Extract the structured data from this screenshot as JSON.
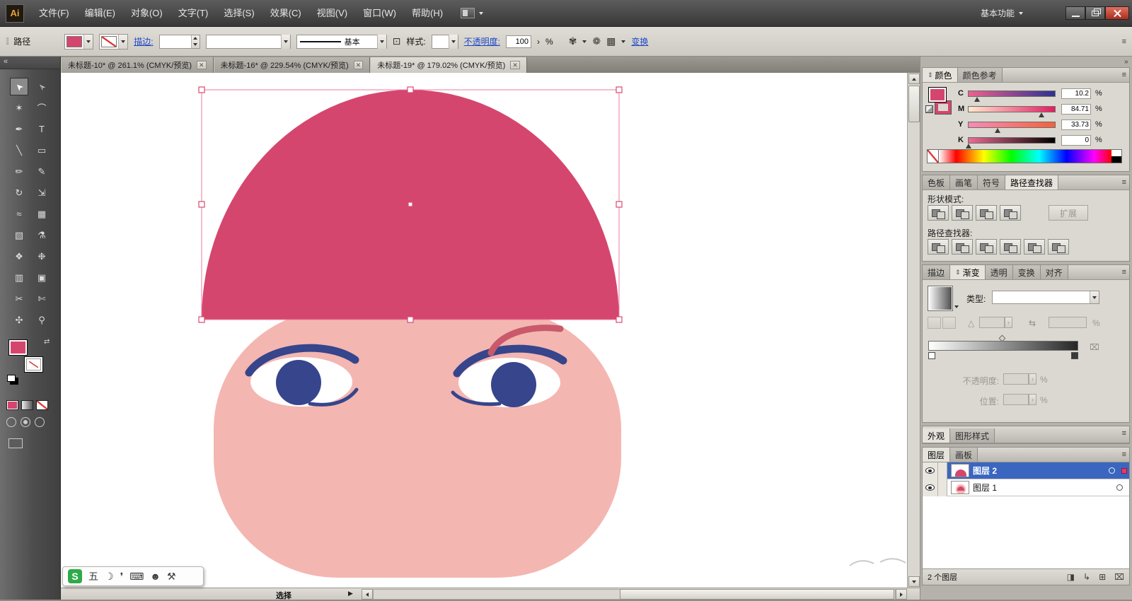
{
  "colors": {
    "hat_pink": "#d5466e",
    "face_pink": "#f4b6b1",
    "eye_navy": "#36458c",
    "brow_pink": "#c9596b",
    "selection_pink": "#e87da0",
    "link_blue": "#1f49c7",
    "layer_highlight": "#3a66c0",
    "ime_green": "#2faa4a"
  },
  "titlebar": {
    "logo": "Ai",
    "menus": [
      "文件(F)",
      "编辑(E)",
      "对象(O)",
      "文字(T)",
      "选择(S)",
      "效果(C)",
      "视图(V)",
      "窗口(W)",
      "帮助(H)"
    ],
    "workspace": "基本功能"
  },
  "controlbar": {
    "context_label": "路径",
    "stroke_link": "描边:",
    "basic_style": "基本",
    "style_label": "样式:",
    "opacity_link": "不透明度:",
    "opacity_value": "100",
    "percent": "%",
    "transform_link": "变换"
  },
  "doc_tabs": [
    {
      "title": "未标题-10* @ 261.1% (CMYK/预览)"
    },
    {
      "title": "未标题-16* @ 229.54% (CMYK/预览)"
    },
    {
      "title": "未标题-19* @ 179.02% (CMYK/预览)"
    }
  ],
  "toolbar": {
    "tools": [
      {
        "name": "selection",
        "glyph": "➤"
      },
      {
        "name": "direct-selection",
        "glyph": "➢"
      },
      {
        "name": "magic-wand",
        "glyph": "✶"
      },
      {
        "name": "lasso",
        "glyph": "⌒"
      },
      {
        "name": "pen",
        "glyph": "✒"
      },
      {
        "name": "type",
        "glyph": "T"
      },
      {
        "name": "line-segment",
        "glyph": "╲"
      },
      {
        "name": "rectangle",
        "glyph": "▭"
      },
      {
        "name": "paintbrush",
        "glyph": "✏"
      },
      {
        "name": "pencil",
        "glyph": "✎"
      },
      {
        "name": "rotate",
        "glyph": "↻"
      },
      {
        "name": "scale",
        "glyph": "⇲"
      },
      {
        "name": "width",
        "glyph": "≈"
      },
      {
        "name": "mesh",
        "glyph": "▦"
      },
      {
        "name": "gradient",
        "glyph": "▧"
      },
      {
        "name": "eyedropper",
        "glyph": "⚗"
      },
      {
        "name": "blend",
        "glyph": "❖"
      },
      {
        "name": "symbol-sprayer",
        "glyph": "❉"
      },
      {
        "name": "column-graph",
        "glyph": "▥"
      },
      {
        "name": "artboard",
        "glyph": "▣"
      },
      {
        "name": "slice",
        "glyph": "✂"
      },
      {
        "name": "knife",
        "glyph": "✄"
      },
      {
        "name": "hand",
        "glyph": "✣"
      },
      {
        "name": "zoom",
        "glyph": "⚲"
      }
    ]
  },
  "color_panel": {
    "tabs": [
      "颜色",
      "颜色参考"
    ],
    "channels": [
      {
        "label": "C",
        "value": "10.2"
      },
      {
        "label": "M",
        "value": "84.71"
      },
      {
        "label": "Y",
        "value": "33.73"
      },
      {
        "label": "K",
        "value": "0"
      }
    ],
    "unit": "%"
  },
  "pathfinder_panel": {
    "tabs": [
      "色板",
      "画笔",
      "符号",
      "路径查找器"
    ],
    "shape_mode_label": "形状模式:",
    "expand_label": "扩展",
    "pathfinder_label": "路径查找器:"
  },
  "gradient_panel": {
    "tabs": [
      "描边",
      "渐变",
      "透明",
      "变换",
      "对齐"
    ],
    "type_label": "类型:",
    "opacity_label": "不透明度:",
    "location_label": "位置:",
    "unit": "%"
  },
  "appearance_panel": {
    "tabs": [
      "外观",
      "图形样式"
    ]
  },
  "layers_panel": {
    "tabs": [
      "图层",
      "画板"
    ],
    "layers": [
      {
        "name": "图层 2"
      },
      {
        "name": "图层 1"
      }
    ],
    "count_label": "2 个图层"
  },
  "statusbar": {
    "tool_label": "选择"
  },
  "ime": {
    "logo": "S",
    "items": [
      "五",
      "☽",
      "❜",
      "⌨",
      "☻",
      "⚒"
    ]
  },
  "glyphs": {
    "close": "✕",
    "collapse": "«",
    "panel_menu": "≡",
    "cycle": "⇕",
    "status_arrow": "▶",
    "swap": "⇄",
    "angle": "△",
    "spin": "›",
    "recolor": "✾",
    "flower": "❁",
    "grid": "▩",
    "align_box": "⊡",
    "reverse": "⇆",
    "clip_mask": "◨",
    "new_sublayer": "↳",
    "new_layer": "⊞",
    "delete_layer": "⌧"
  }
}
